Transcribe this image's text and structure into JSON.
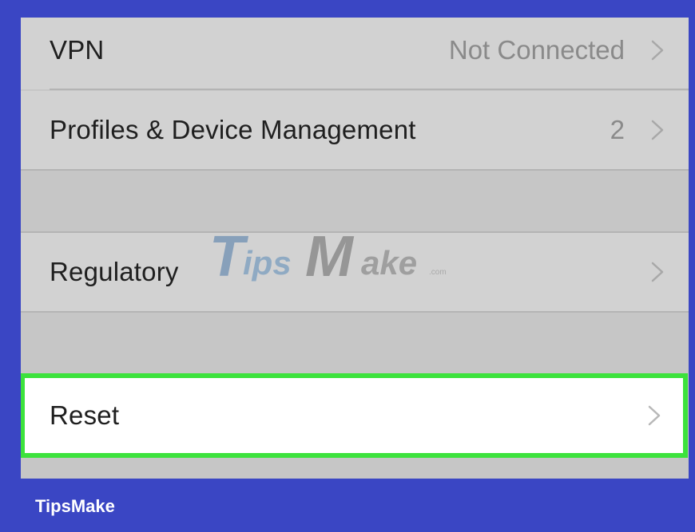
{
  "settings": {
    "rows": [
      {
        "label": "VPN",
        "value": "Not Connected"
      },
      {
        "label": "Profiles & Device Management",
        "value": "2"
      },
      {
        "label": "Regulatory",
        "value": ""
      },
      {
        "label": "Reset",
        "value": ""
      }
    ],
    "highlighted": "Reset"
  },
  "watermark": {
    "main": "TipsMake",
    "suffix": ".com"
  },
  "footer": {
    "brand": "TipsMake"
  },
  "colors": {
    "frame": "#3a46c4",
    "highlight": "#3ce23c",
    "row_bg": "#d2d2d2",
    "group_gap": "#c6c6c6",
    "value_text": "#8a8a8a"
  }
}
